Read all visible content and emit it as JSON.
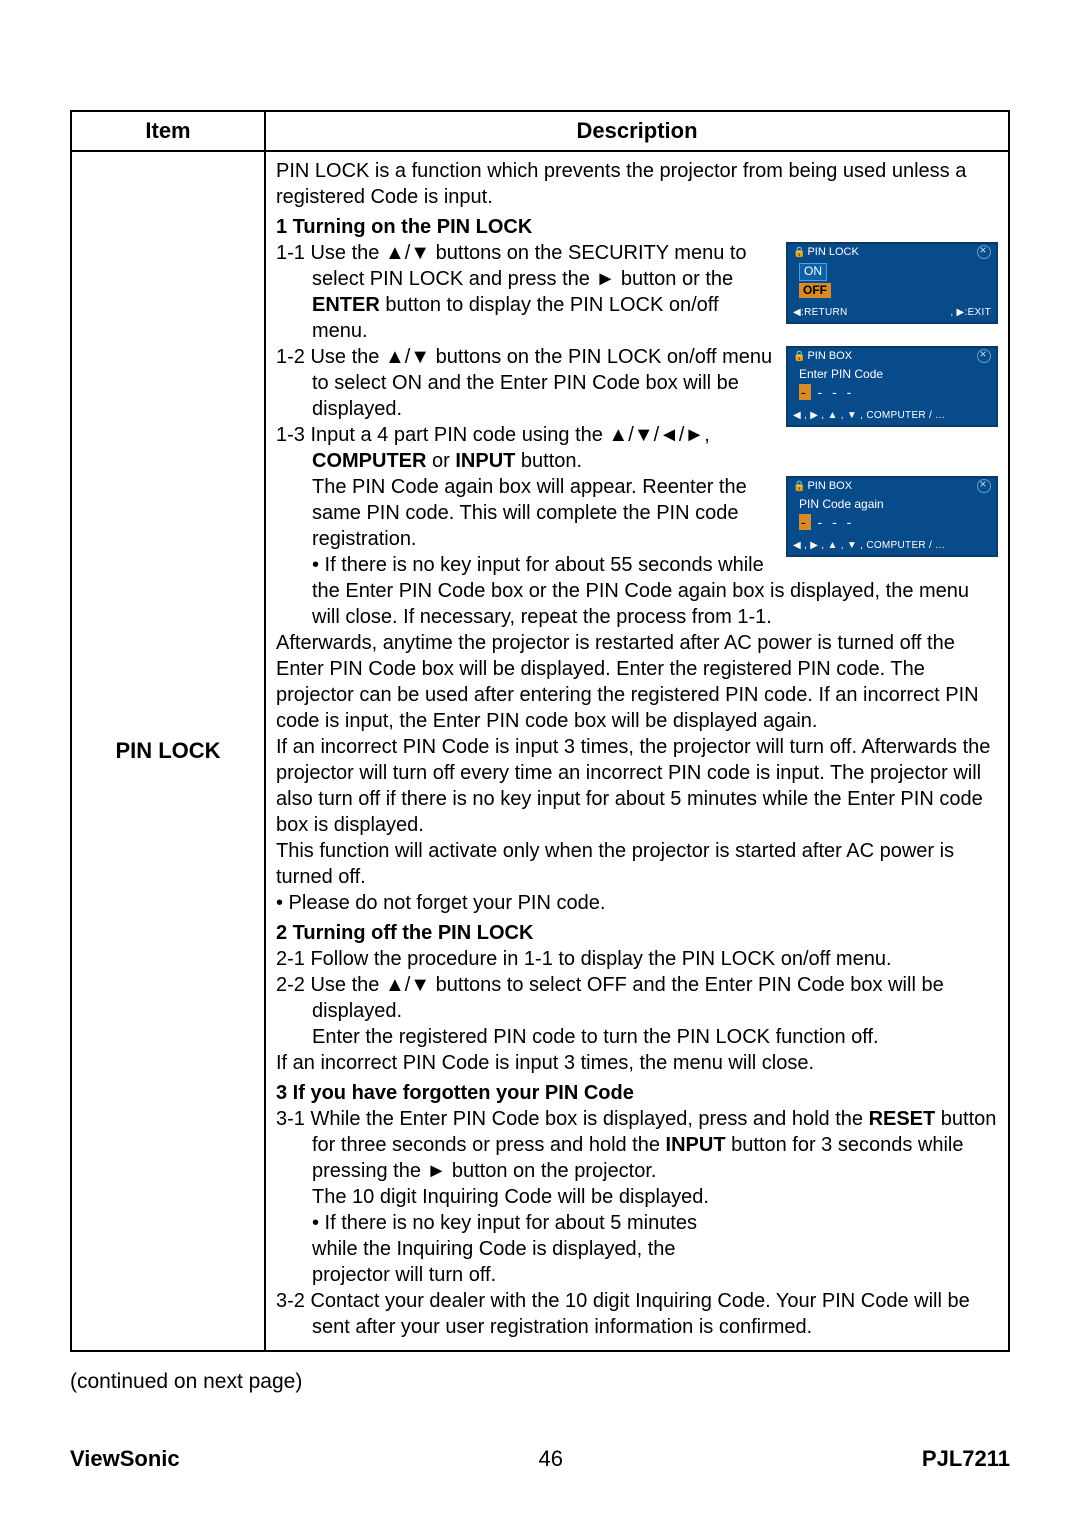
{
  "table": {
    "header_item": "Item",
    "header_desc": "Description",
    "item_name": "PIN LOCK"
  },
  "intro": "PIN LOCK is a function which prevents the projector from being used unless a registered Code is input.",
  "sec1_title": "1 Turning on the PIN LOCK",
  "sec1_1a": "1-1 Use the ▲/▼ buttons on the SECURITY menu to select PIN LOCK and press the ► button or the ",
  "sec1_1_enter": "ENTER",
  "sec1_1b": " button to display the PIN LOCK on/off menu.",
  "sec1_2": "1-2 Use the ▲/▼ buttons on the PIN LOCK on/off menu to select ON and the Enter PIN Code box will be displayed.",
  "sec1_3a": "1-3 Input a 4 part PIN code using the ▲/▼/◄/►, ",
  "sec1_3_comp": "COMPUTER",
  "sec1_3_or": " or ",
  "sec1_3_input": "INPUT",
  "sec1_3b": " button.",
  "sec1_3_para": "The PIN Code again box will appear. Reenter the same PIN code. This will complete the PIN code registration.",
  "sec1_bullet": "• If there is no key input for about 55 seconds while the Enter PIN Code box or the PIN Code again box is displayed, the menu will close. If necessary, repeat the process from 1-1.",
  "para_after_a": "Afterwards, anytime the projector is restarted after AC power  is turned off the Enter PIN Code box will be displayed. Enter the registered PIN code. The projector can be used after entering the registered PIN code. If an incorrect PIN code is input, the Enter PIN code box will be displayed again.",
  "para_after_b": "If an incorrect PIN Code is input 3 times, the projector will turn off. Afterwards the projector will turn off every time an incorrect PIN code is input. The projector will also turn off if there is no key input for about 5 minutes while the Enter PIN code box is displayed.",
  "para_after_c": "This function will activate only when the projector is started after AC power is turned off.",
  "para_forget": "• Please do not forget your PIN code.",
  "sec2_title": "2 Turning off the PIN LOCK",
  "sec2_1": "2-1 Follow the procedure in 1-1 to display the PIN LOCK on/off menu.",
  "sec2_2": "2-2 Use the ▲/▼ buttons to select OFF and the Enter PIN Code box will be displayed.",
  "sec2_2b": "Enter the registered PIN code to turn the PIN LOCK function off.",
  "sec2_wrong": "If an incorrect PIN Code is input 3 times, the menu will close.",
  "sec3_title": "3 If you have forgotten your PIN Code",
  "sec3_1a": "3-1 While the Enter PIN Code box is displayed, press and hold the ",
  "sec3_reset": "RESET",
  "sec3_1b": " button for three seconds or press and hold the ",
  "sec3_input": "INPUT",
  "sec3_1c": " button for 3 seconds while pressing the ► button on the projector.",
  "sec3_1d": "The 10 digit Inquiring Code will be displayed.",
  "sec3_bullet": "• If there is no key input for about 5 minutes while the Inquiring Code is displayed, the projector will turn off.",
  "sec3_2": "3-2 Contact your dealer with the 10 digit Inquiring Code. Your PIN Code will be sent after your user registration information is confirmed.",
  "osd1": {
    "title": "PIN LOCK",
    "on": "ON",
    "off": "OFF",
    "footer_l": "◀:RETURN",
    "footer_r": ", ▶:EXIT"
  },
  "osd2": {
    "title": "PIN BOX",
    "prompt": "Enter PIN Code",
    "footer": "◀ , ▶ , ▲ , ▼ , COMPUTER / …"
  },
  "osd3": {
    "title": "PIN BOX",
    "prompt": "PIN Code again",
    "footer": "◀ , ▶ , ▲ , ▼ , COMPUTER / …"
  },
  "continued": "(continued on next page)",
  "footer": {
    "brand": "ViewSonic",
    "page": "46",
    "model": "PJL7211"
  }
}
